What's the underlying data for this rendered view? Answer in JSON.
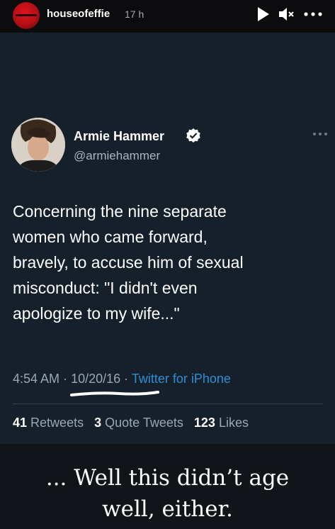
{
  "story": {
    "username": "houseofeffie",
    "time": "17 h",
    "icons": [
      "play-icon",
      "mute-icon",
      "more-icon"
    ]
  },
  "tweet": {
    "display_name": "Armie Hammer",
    "handle": "@armiehammer",
    "text": "Concerning the nine separate\nwomen who came forward,\nbravely, to accuse him of sexual\nmisconduct: \"I didn't even\napologize to my wife...\"",
    "time": "4:54 AM",
    "date": "10/20/16",
    "source": "Twitter for iPhone",
    "retweets_count": "41",
    "retweets_label": "Retweets",
    "quote_count": "3",
    "quote_label": "Quote Tweets",
    "likes_count": "123",
    "likes_label": "Likes",
    "verified_color": "#ffffff"
  },
  "caption": "... Well this didn’t age\nwell, either.",
  "colors": {
    "story_bg": "#0c0c0e",
    "tweet_bg": "#15202b",
    "link": "#2c8fd8",
    "muted_text": "#9aa8b5"
  }
}
